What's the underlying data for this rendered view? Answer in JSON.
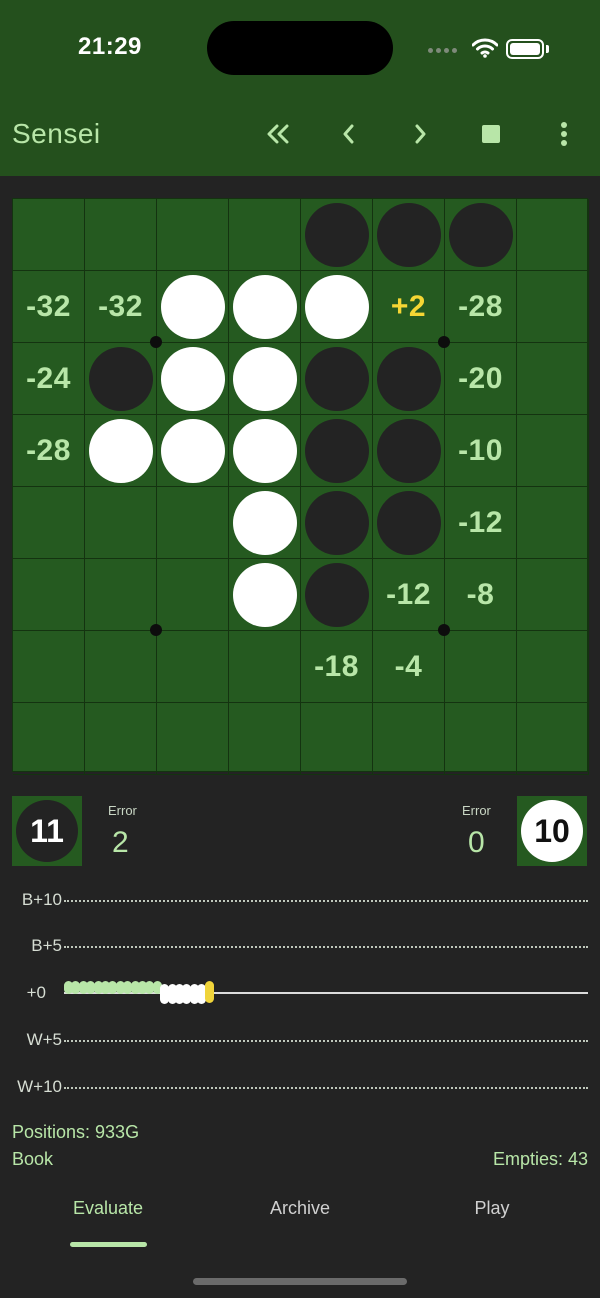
{
  "status_bar": {
    "time": "21:29"
  },
  "app_bar": {
    "title": "Sensei",
    "tools": [
      "double-chevron-left-icon",
      "chevron-left-icon",
      "chevron-right-icon",
      "stop-icon",
      "more-vert-icon"
    ]
  },
  "board": {
    "rows": [
      [
        "",
        "",
        "",
        "",
        "B",
        "B",
        "B",
        ""
      ],
      [
        "-32",
        "-32",
        "W",
        "W",
        "W",
        "+2",
        "-28",
        ""
      ],
      [
        "-24",
        "B",
        "W",
        "W",
        "B",
        "B",
        "-20",
        ""
      ],
      [
        "-28",
        "W",
        "W",
        "W",
        "B",
        "B",
        "-10",
        ""
      ],
      [
        "",
        "",
        "",
        "W",
        "B",
        "B",
        "-12",
        ""
      ],
      [
        "",
        "",
        "",
        "W",
        "B",
        "-12",
        "-8",
        ""
      ],
      [
        "",
        "",
        "",
        "",
        "-18",
        "-4",
        "",
        ""
      ],
      [
        "",
        "",
        "",
        "",
        "",
        "",
        "",
        ""
      ]
    ],
    "best_move": "+2"
  },
  "score": {
    "black": {
      "count": "11",
      "error_label": "Error",
      "error": "2"
    },
    "white": {
      "count": "10",
      "error_label": "Error",
      "error": "0"
    }
  },
  "graph": {
    "labels": {
      "b10": "B+10",
      "b5": "B+5",
      "zero": "+0",
      "w5": "W+5",
      "w10": "W+10"
    },
    "moves": [
      "black",
      "black",
      "black",
      "black",
      "black",
      "black",
      "black",
      "black",
      "black",
      "black",
      "black",
      "black",
      "black",
      "white",
      "white",
      "white",
      "white",
      "white",
      "white",
      "current"
    ],
    "colors": {
      "black": "#b8e6a8",
      "white": "#ffffff",
      "current": "#f0d43a"
    }
  },
  "info": {
    "positions": "Positions: 933G",
    "book": "Book",
    "empties": "Empties: 43"
  },
  "tabs": [
    {
      "label": "Evaluate",
      "active": true
    },
    {
      "label": "Archive",
      "active": false
    },
    {
      "label": "Play",
      "active": false
    }
  ],
  "theme": {
    "board_green": "#255a20",
    "header_green": "#24501d",
    "eval_color": "#b8e6a8",
    "best_color": "#f5d634",
    "background": "#232323"
  }
}
